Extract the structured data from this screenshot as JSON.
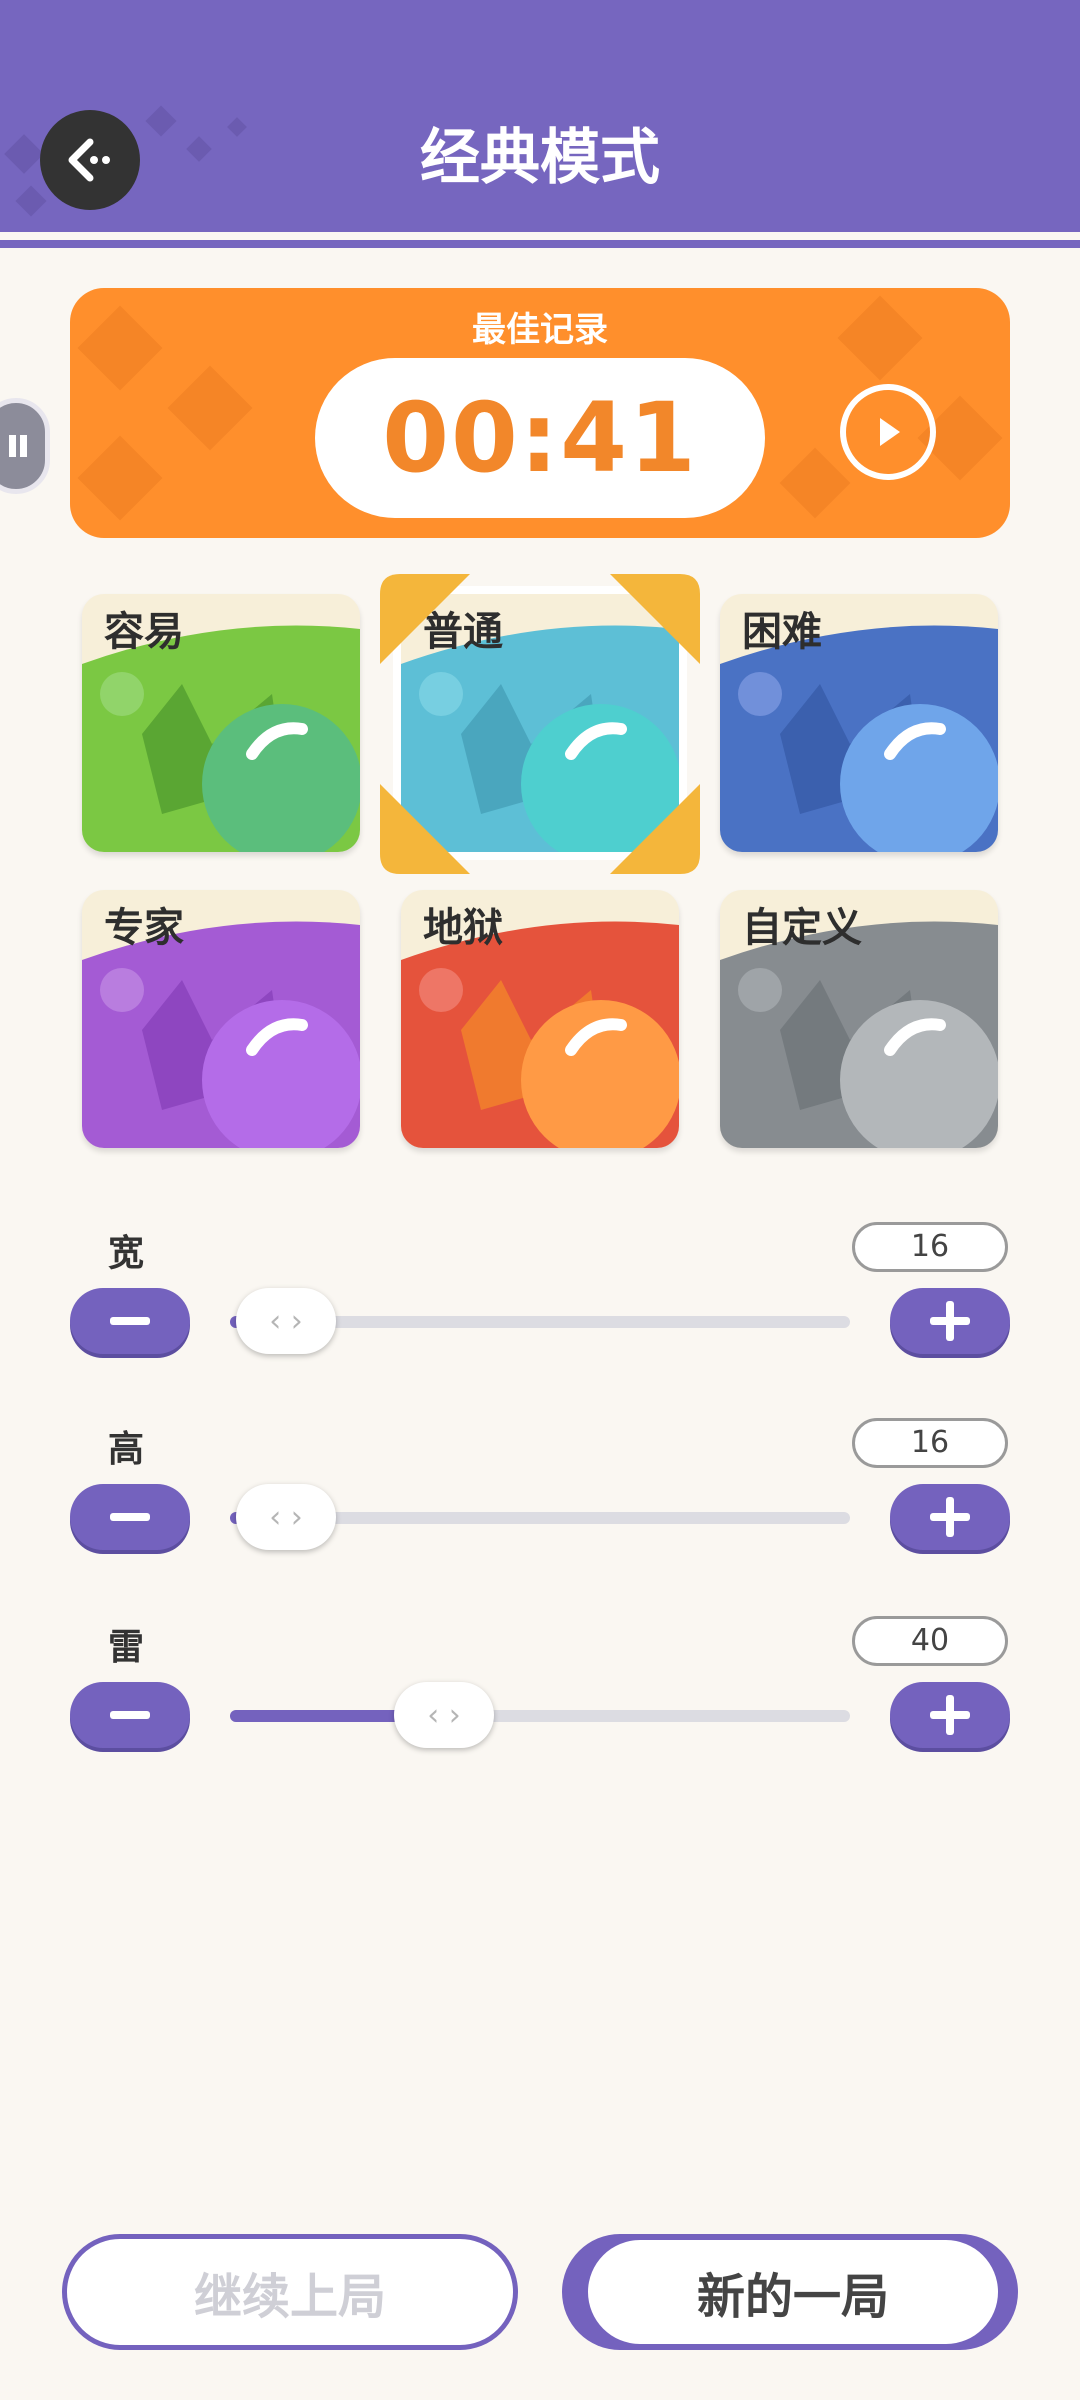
{
  "header": {
    "title": "经典模式"
  },
  "record": {
    "label": "最佳记录",
    "time": "00:41"
  },
  "modes": [
    {
      "label": "容易",
      "color": "#7BC843"
    },
    {
      "label": "普通",
      "color": "#5DBFD6"
    },
    {
      "label": "困难",
      "color": "#4A72C4"
    },
    {
      "label": "专家",
      "color": "#A45BD4"
    },
    {
      "label": "地狱",
      "color": "#E5533C"
    },
    {
      "label": "自定义",
      "color": "#878C90"
    }
  ],
  "settings": [
    {
      "label": "宽",
      "value": "16",
      "level": 0
    },
    {
      "label": "高",
      "value": "16",
      "level": 0
    },
    {
      "label": "雷",
      "value": "40",
      "level": 0.3
    }
  ],
  "buttons": {
    "continue": "继续上局",
    "new_game": "新的一局"
  },
  "colors": {
    "accent": "#7462BE",
    "record": "#FF8F2C"
  }
}
